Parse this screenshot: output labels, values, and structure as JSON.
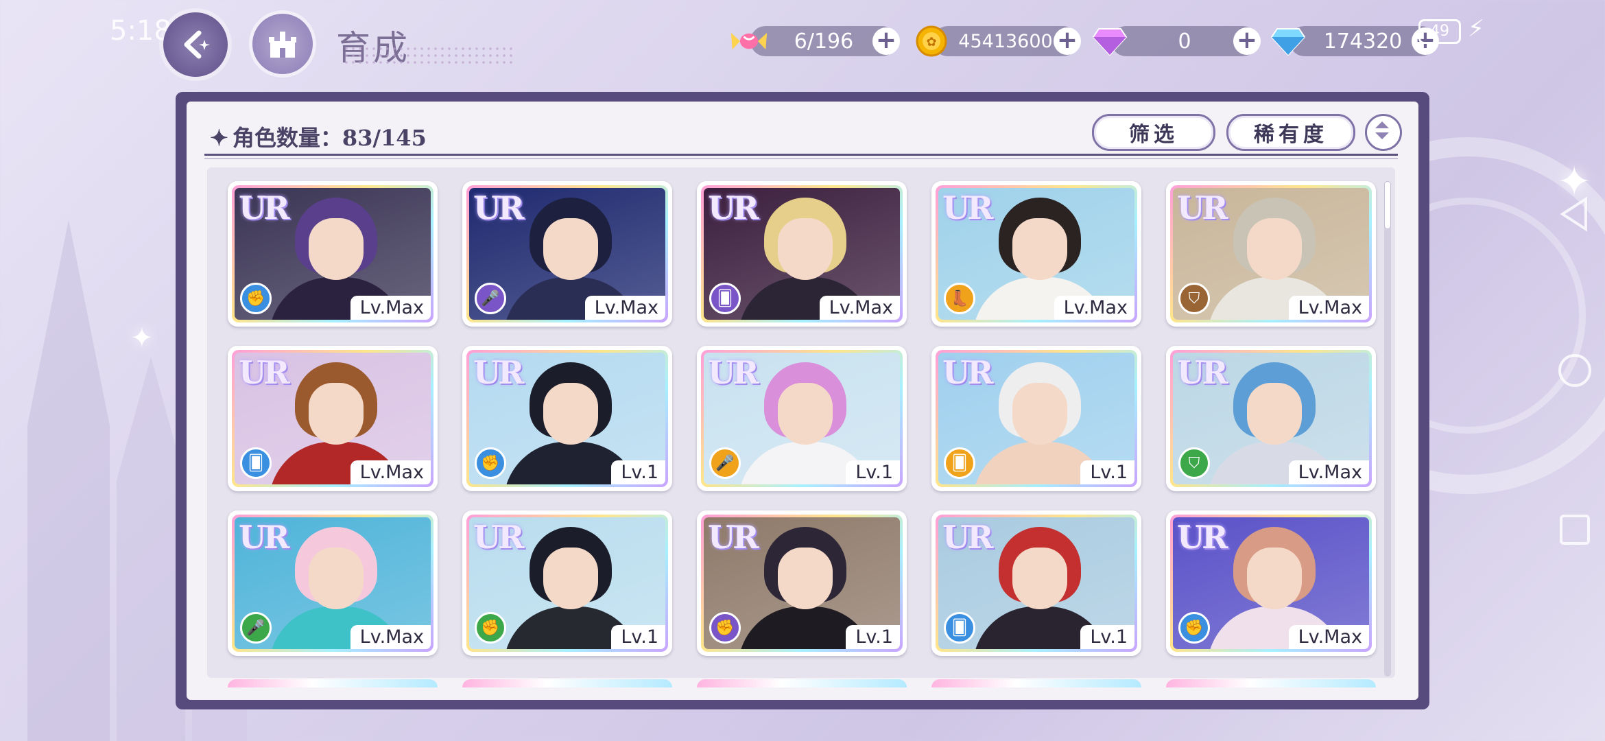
{
  "status": {
    "time": "5:18",
    "battery": "49"
  },
  "header": {
    "title": "育成",
    "title_deco_text": "Growth"
  },
  "resources": [
    {
      "name": "candy",
      "icon": "candy-icon",
      "value": "6/196"
    },
    {
      "name": "gold",
      "icon": "gold-coin-icon",
      "value": "45413600"
    },
    {
      "name": "pink-gem",
      "icon": "pink-diamond-icon",
      "value": "0"
    },
    {
      "name": "blue-gem",
      "icon": "blue-diamond-icon",
      "value": "174320"
    }
  ],
  "panel": {
    "count_label": "角色数量：83/145",
    "filter_label": "筛选",
    "rarity_label": "稀有度"
  },
  "colors": {
    "accent": "#574a7c",
    "panel_bg": "#f4f2f7"
  },
  "cards": [
    {
      "rarity": "UR",
      "level": "Lv.Max",
      "role_color": "#3a8fe0",
      "role_icon": "fist-icon",
      "hair": "#5a3f8c",
      "outfit": "#2b2240",
      "bg": "#3b3555"
    },
    {
      "rarity": "UR",
      "level": "Lv.Max",
      "role_color": "#7a55c8",
      "role_icon": "mic-icon",
      "hair": "#1e2040",
      "outfit": "#2a2e55",
      "bg": "#1f2a70"
    },
    {
      "rarity": "UR",
      "level": "Lv.Max",
      "role_color": "#7a55c8",
      "role_icon": "cards-icon",
      "hair": "#e6cf8a",
      "outfit": "#2b2536",
      "bg": "#3c1f3e"
    },
    {
      "rarity": "UR",
      "level": "Lv.Max",
      "role_color": "#f0a21a",
      "role_icon": "boot-icon",
      "hair": "#2b2222",
      "outfit": "#f5f3ef",
      "bg": "#9fd2ea"
    },
    {
      "rarity": "UR",
      "level": "Lv.Max",
      "role_color": "#9a6535",
      "role_icon": "shield-icon",
      "hair": "#c9c3b6",
      "outfit": "#e9e6df",
      "bg": "#c9b69a"
    },
    {
      "rarity": "UR",
      "level": "Lv.Max",
      "role_color": "#3a8fe0",
      "role_icon": "cards-icon",
      "hair": "#9b5a2e",
      "outfit": "#b22828",
      "bg": "#d9c2e4"
    },
    {
      "rarity": "UR",
      "level": "Lv.1",
      "role_color": "#3a8fe0",
      "role_icon": "fist-icon",
      "hair": "#1b1d2a",
      "outfit": "#1f2230",
      "bg": "#b4daf0"
    },
    {
      "rarity": "UR",
      "level": "Lv.1",
      "role_color": "#f0a21a",
      "role_icon": "mic-icon",
      "hair": "#d98fd9",
      "outfit": "#f4f3f6",
      "bg": "#c9e2f0"
    },
    {
      "rarity": "UR",
      "level": "Lv.1",
      "role_color": "#f0a21a",
      "role_icon": "cards-icon",
      "hair": "#eeeeee",
      "outfit": "#f1d2bf",
      "bg": "#9fd0ee"
    },
    {
      "rarity": "UR",
      "level": "Lv.Max",
      "role_color": "#3ca84a",
      "role_icon": "shield-icon",
      "hair": "#5d9ed6",
      "outfit": "#d8dbe6",
      "bg": "#bcd7e5"
    },
    {
      "rarity": "UR",
      "level": "Lv.Max",
      "role_color": "#3ca84a",
      "role_icon": "mic-icon",
      "hair": "#f5c8dc",
      "outfit": "#3ec2c8",
      "bg": "#4fb4d9"
    },
    {
      "rarity": "UR",
      "level": "Lv.1",
      "role_color": "#3ca84a",
      "role_icon": "fist-icon",
      "hair": "#1b1d2a",
      "outfit": "#262a30",
      "bg": "#b9ddee"
    },
    {
      "rarity": "UR",
      "level": "Lv.1",
      "role_color": "#7a55c8",
      "role_icon": "fist-icon",
      "hair": "#2d2636",
      "outfit": "#1f1b22",
      "bg": "#8f7a6a"
    },
    {
      "rarity": "UR",
      "level": "Lv.1",
      "role_color": "#3a8fe0",
      "role_icon": "cards-icon",
      "hair": "#c4302f",
      "outfit": "#2a2430",
      "bg": "#a9cbe0"
    },
    {
      "rarity": "UR",
      "level": "Lv.Max",
      "role_color": "#3a8fe0",
      "role_icon": "fist-icon",
      "hair": "#d89c86",
      "outfit": "#efe0ec",
      "bg": "#5a52c8"
    }
  ]
}
